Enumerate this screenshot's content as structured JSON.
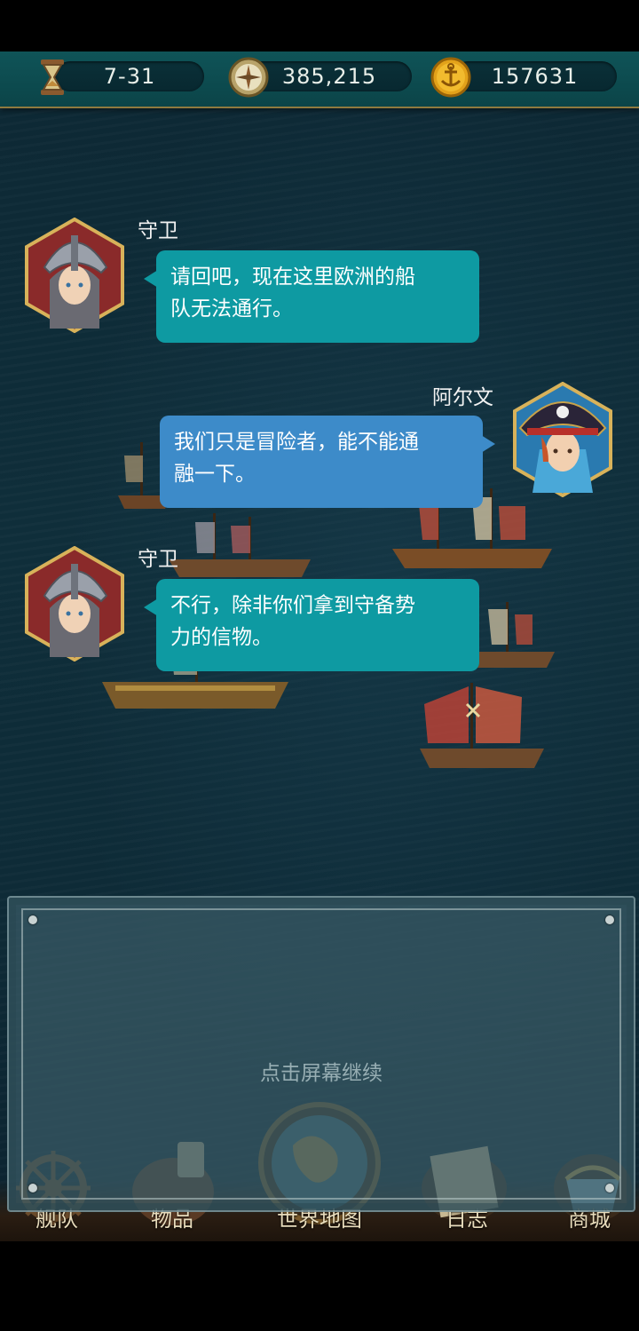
{
  "resources": [
    {
      "icon": "hourglass-icon",
      "value": "7-31"
    },
    {
      "icon": "compass-icon",
      "value": "385,215"
    },
    {
      "icon": "anchor-coin-icon",
      "value": "157631"
    }
  ],
  "dialogue": [
    {
      "speaker": "守卫",
      "line1": "请回吧，现在这里欧洲的船",
      "line2": "队无法通行。"
    },
    {
      "speaker": "阿尔文",
      "line1": "我们只是冒险者，能不能通",
      "line2": "融一下。"
    },
    {
      "speaker": "守卫",
      "line1": "不行，除非你们拿到守备势",
      "line2": "力的信物。"
    }
  ],
  "continue_prompt": "点击屏幕继续",
  "nav": [
    {
      "label": "舰队",
      "icon": "ship-wheel-icon"
    },
    {
      "label": "物品",
      "icon": "bag-icon"
    },
    {
      "label": "世界地图",
      "icon": "globe-icon"
    },
    {
      "label": "日志",
      "icon": "scroll-icon"
    },
    {
      "label": "商城",
      "icon": "shop-icon"
    }
  ],
  "colors": {
    "guard_bubble": "#0e9aa2",
    "player_bubble": "#3d8bc9",
    "topbar": "#0f5458"
  }
}
